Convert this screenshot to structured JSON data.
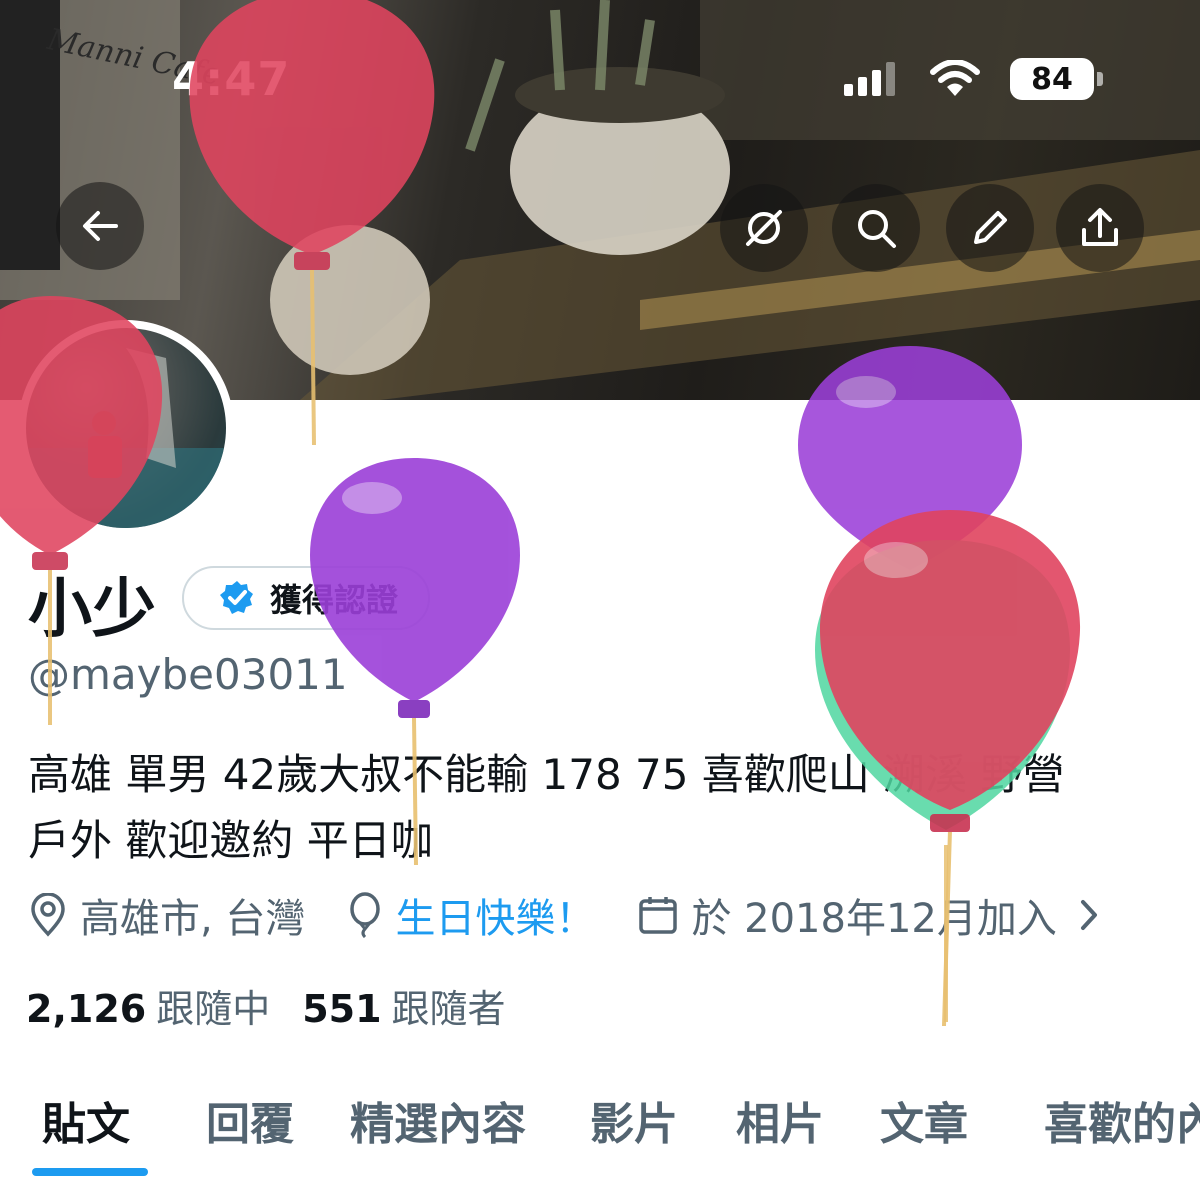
{
  "status_bar": {
    "time": "4:47",
    "battery": "84"
  },
  "banner": {
    "cafe_sign": "Manni Cafe"
  },
  "header_actions": [
    "back-icon",
    "grok-icon",
    "search-icon",
    "edit-icon",
    "share-icon"
  ],
  "profile": {
    "name": "小少",
    "verified_label": "獲得認證",
    "handle": "@maybe03011",
    "bio_line1": "高雄 單男 42歲大叔不能輸 178 75 喜歡爬山 溯溪 野營",
    "bio_line2": "戶外 歡迎邀約 平日咖",
    "location": "高雄市, 台灣",
    "birthday": "生日快樂！",
    "joined": "於 2018年12月加入"
  },
  "stats": {
    "following_count": "2,126",
    "following_label": "跟隨中",
    "followers_count": "551",
    "followers_label": "跟隨者"
  },
  "tabs": [
    "貼文",
    "回覆",
    "精選內容",
    "影片",
    "相片",
    "文章",
    "喜歡的內容"
  ],
  "active_tab": "貼文",
  "colors": {
    "accent": "#1d9bf0",
    "muted": "#536471",
    "text": "#0f1419",
    "balloon_red": "#e0445f",
    "balloon_purple": "#9b3fd8",
    "balloon_green": "#4fd6a0"
  }
}
